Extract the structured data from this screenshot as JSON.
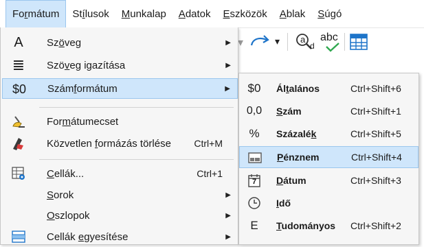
{
  "menubar": [
    {
      "pre": "Fo",
      "acc": "r",
      "post": "mátum",
      "active": true
    },
    {
      "pre": "St",
      "acc": "í",
      "post": "lusok",
      "active": false
    },
    {
      "pre": "",
      "acc": "M",
      "post": "unkalap",
      "active": false
    },
    {
      "pre": "",
      "acc": "A",
      "post": "datok",
      "active": false
    },
    {
      "pre": "",
      "acc": "E",
      "post": "szközök",
      "active": false
    },
    {
      "pre": "",
      "acc": "A",
      "post": "blak",
      "active": false
    },
    {
      "pre": "",
      "acc": "S",
      "post": "úgó",
      "active": false
    }
  ],
  "toolbar": {
    "icons": [
      "redo-icon",
      "find-replace-icon",
      "spellcheck-icon",
      "table-icon"
    ],
    "spell_text": "abc",
    "find_letter": "a",
    "find_sub": "d"
  },
  "menu": {
    "items": [
      {
        "icon": "text-icon",
        "glyph": "A",
        "pre": "Sz",
        "acc": "ö",
        "post": "veg",
        "shortcut": "",
        "arrow": true,
        "hl": false
      },
      {
        "icon": "align-icon",
        "glyph": "≣",
        "pre": "Szö",
        "acc": "v",
        "post": "eg igazítása",
        "shortcut": "",
        "arrow": true,
        "hl": false
      },
      {
        "icon": "number-format-icon",
        "glyph": "$0",
        "pre": "Szám",
        "acc": "f",
        "post": "ormátum",
        "shortcut": "",
        "arrow": true,
        "hl": true
      },
      {
        "icon": "clone-formatting-icon",
        "glyph": "",
        "pre": "For",
        "acc": "m",
        "post": "átumecset",
        "shortcut": "",
        "arrow": false,
        "hl": false
      },
      {
        "icon": "clear-formatting-icon",
        "glyph": "",
        "pre": "Közvetlen ",
        "acc": "f",
        "post": "ormázás törlése",
        "shortcut": "Ctrl+M",
        "arrow": false,
        "hl": false
      },
      {
        "icon": "cells-icon",
        "glyph": "",
        "pre": "",
        "acc": "C",
        "post": "ellák...",
        "shortcut": "Ctrl+1",
        "arrow": false,
        "hl": false
      },
      {
        "icon": "",
        "glyph": "",
        "pre": "",
        "acc": "S",
        "post": "orok",
        "shortcut": "",
        "arrow": true,
        "hl": false
      },
      {
        "icon": "",
        "glyph": "",
        "pre": "",
        "acc": "O",
        "post": "szlopok",
        "shortcut": "",
        "arrow": true,
        "hl": false
      },
      {
        "icon": "merge-cells-icon",
        "glyph": "",
        "pre": "Cellák ",
        "acc": "e",
        "post": "gyesítése",
        "shortcut": "",
        "arrow": true,
        "hl": false
      }
    ]
  },
  "submenu": {
    "items": [
      {
        "icon": "number-format-icon",
        "glyph": "$0",
        "pre": "Ál",
        "acc": "t",
        "post": "alános",
        "shortcut": "Ctrl+Shift+6",
        "hl": false
      },
      {
        "icon": "number-icon",
        "glyph": "0,0",
        "pre": "",
        "acc": "S",
        "post": "zám",
        "shortcut": "Ctrl+Shift+1",
        "hl": false
      },
      {
        "icon": "percent-icon",
        "glyph": "%",
        "pre": "Százalé",
        "acc": "k",
        "post": "",
        "shortcut": "Ctrl+Shift+5",
        "hl": false
      },
      {
        "icon": "currency-icon",
        "glyph": "",
        "pre": "",
        "acc": "P",
        "post": "énznem",
        "shortcut": "Ctrl+Shift+4",
        "hl": true
      },
      {
        "icon": "calendar-icon",
        "glyph": "7",
        "pre": "",
        "acc": "D",
        "post": "átum",
        "shortcut": "Ctrl+Shift+3",
        "hl": false
      },
      {
        "icon": "clock-icon",
        "glyph": "",
        "pre": "",
        "acc": "I",
        "post": "dő",
        "shortcut": "",
        "hl": false
      },
      {
        "icon": "scientific-icon",
        "glyph": "E",
        "pre": "",
        "acc": "T",
        "post": "udományos",
        "shortcut": "Ctrl+Shift+2",
        "hl": false
      }
    ]
  }
}
